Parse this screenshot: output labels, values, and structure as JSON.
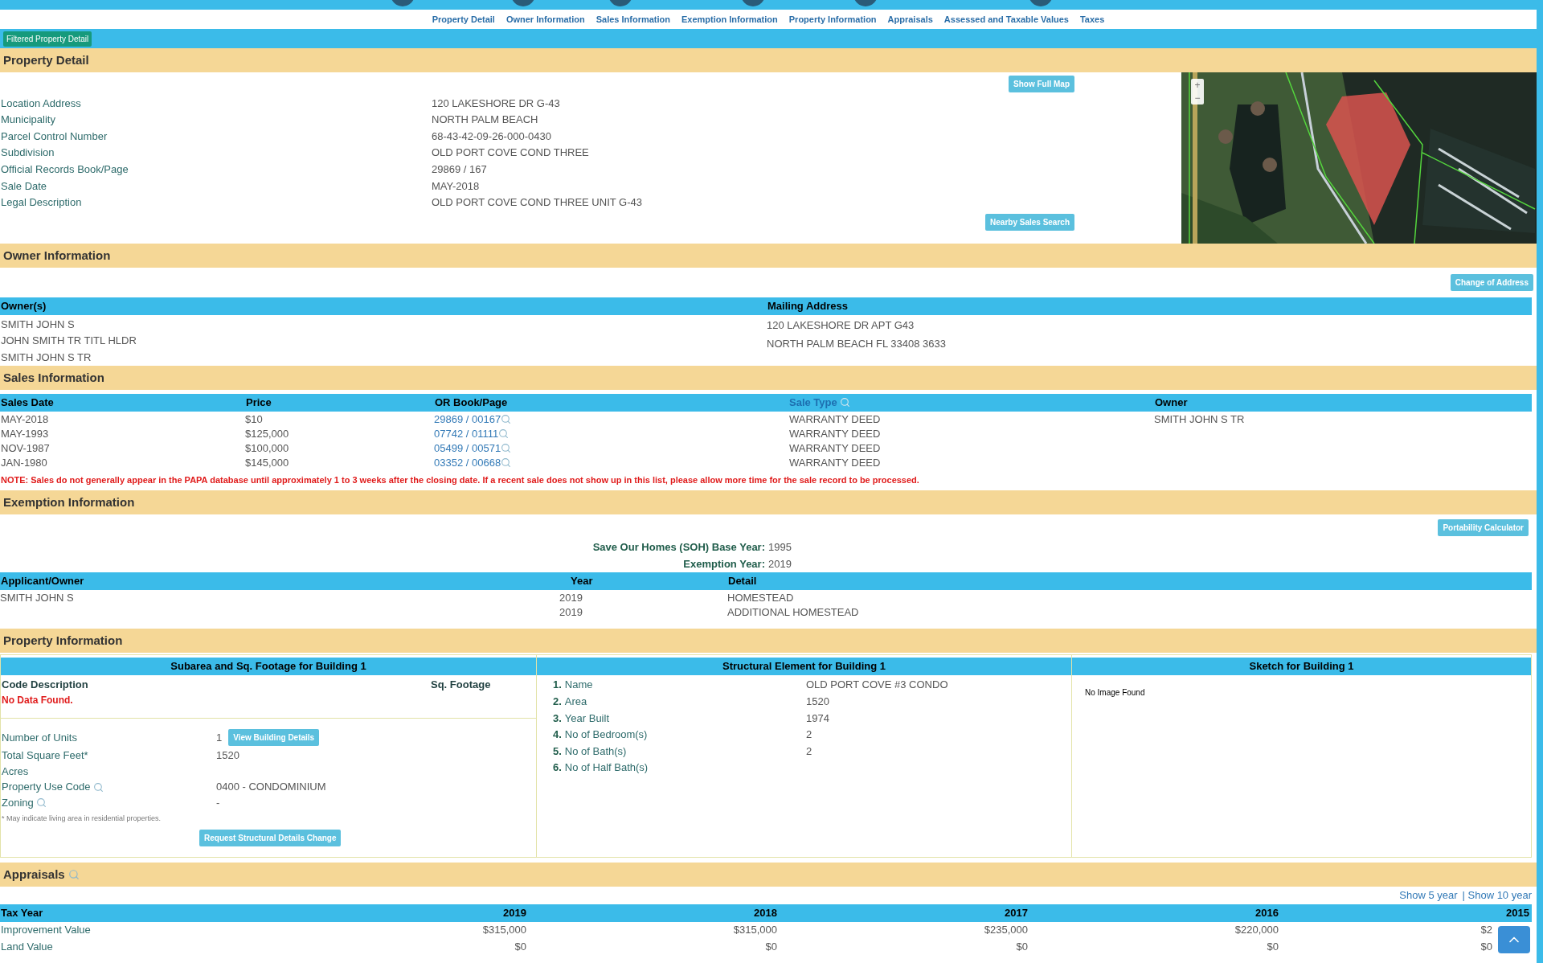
{
  "nav": {
    "links": [
      "Property Detail",
      "Owner Information",
      "Sales Information",
      "Exemption Information",
      "Property Information",
      "Appraisals",
      "Assessed and Taxable Values",
      "Taxes"
    ]
  },
  "filter_badge": "Filtered Property Detail",
  "property_detail": {
    "title": "Property Detail",
    "show_map_button": "Show Full Map",
    "nearby_button": "Nearby Sales Search",
    "fields": [
      {
        "label": "Location Address",
        "value": "120 LAKESHORE DR G-43"
      },
      {
        "label": "Municipality",
        "value": "NORTH PALM BEACH"
      },
      {
        "label": "Parcel Control Number",
        "value": "68-43-42-09-26-000-0430"
      },
      {
        "label": "Subdivision",
        "value": "OLD PORT COVE COND THREE"
      },
      {
        "label": "Official Records Book/Page",
        "value": "29869 / 167"
      },
      {
        "label": "Sale Date",
        "value": "MAY-2018"
      },
      {
        "label": "Legal Description",
        "value": "OLD PORT COVE COND THREE UNIT G-43"
      }
    ],
    "map": {
      "zoom_in": "+",
      "zoom_out": "−"
    }
  },
  "owner_information": {
    "title": "Owner Information",
    "button": "Change of Address",
    "columns": [
      "Owner(s)",
      "Mailing Address"
    ],
    "owners": [
      "SMITH JOHN S",
      "JOHN SMITH TR TITL HLDR",
      "SMITH JOHN S TR"
    ],
    "mailing_address": [
      "120 LAKESHORE DR APT G43",
      "NORTH PALM BEACH FL 33408 3633"
    ]
  },
  "sales_information": {
    "title": "Sales Information",
    "columns": [
      {
        "label": "Sales Date",
        "kind": "text"
      },
      {
        "label": "Price",
        "kind": "text"
      },
      {
        "label": "OR Book/Page",
        "kind": "text"
      },
      {
        "label": "Sale Type",
        "kind": "link"
      },
      {
        "label": "Owner",
        "kind": "text"
      }
    ],
    "rows": [
      {
        "date": "MAY-2018",
        "price": "$10",
        "book_page": "29869 / 00167",
        "sale_type": "WARRANTY DEED",
        "owner": "SMITH JOHN S TR"
      },
      {
        "date": "MAY-1993",
        "price": "$125,000",
        "book_page": "07742 / 01111",
        "sale_type": "WARRANTY DEED"
      },
      {
        "date": "NOV-1987",
        "price": "$100,000",
        "book_page": "05499 / 00571",
        "sale_type": "WARRANTY DEED"
      },
      {
        "date": "JAN-1980",
        "price": "$145,000",
        "book_page": "03352 / 00668",
        "sale_type": "WARRANTY DEED"
      }
    ],
    "note": "NOTE: Sales do not generally appear in the PAPA database until approximately 1 to 3 weeks after the closing date. If a recent sale does not show up in this list, please allow more time for the sale record to be processed."
  },
  "exemption_information": {
    "title": "Exemption Information",
    "button": "Portability Calculator",
    "summary": [
      {
        "label": "Save Our Homes (SOH) Base Year:",
        "value": "1995"
      },
      {
        "label": "Exemption Year:",
        "value": "2019"
      }
    ],
    "columns": [
      "Applicant/Owner",
      "Year",
      "Detail"
    ],
    "rows": [
      {
        "applicant": "SMITH JOHN S",
        "year": "2019",
        "detail": "HOMESTEAD"
      },
      {
        "year": "2019",
        "detail": "ADDITIONAL HOMESTEAD"
      }
    ]
  },
  "property_information": {
    "title": "Property Information",
    "subarea": {
      "title": "Subarea and Sq. Footage for Building 1",
      "columns": [
        "Code Description",
        "Sq. Footage"
      ],
      "no_data": "No Data Found.",
      "fields": [
        {
          "label": "Number of Units",
          "value": "1",
          "button": "View Building Details"
        },
        {
          "label": "Total Square Feet*",
          "value": "1520"
        },
        {
          "label": "Acres"
        },
        {
          "label": "Property Use Code",
          "value": "0400 - CONDOMINIUM",
          "search": true
        },
        {
          "label": "Zoning",
          "value": "-",
          "search": true
        }
      ],
      "footnote": "* May indicate living area in residential properties.",
      "button": "Request Structural Details Change"
    },
    "structural": {
      "title": "Structural Element for Building 1",
      "items": [
        {
          "number": "1.",
          "label": "Name",
          "value": "OLD PORT COVE #3 CONDO"
        },
        {
          "number": "2.",
          "label": "Area",
          "value": "1520"
        },
        {
          "number": "3.",
          "label": "Year Built",
          "value": "1974"
        },
        {
          "number": "4.",
          "label": "No of Bedroom(s)",
          "value": "2"
        },
        {
          "number": "5.",
          "label": "No of Bath(s)",
          "value": "2"
        },
        {
          "number": "6.",
          "label": "No of Half Bath(s)"
        }
      ]
    },
    "sketch": {
      "title": "Sketch for Building 1",
      "text": "No Image Found"
    }
  },
  "appraisals": {
    "title": "Appraisals",
    "links": [
      "Show 5 year",
      "| Show 10 year"
    ],
    "columns": [
      "Tax Year",
      "2019",
      "2018",
      "2017",
      "2016",
      "2015"
    ],
    "rows": [
      {
        "label": "Improvement Value",
        "values": [
          "$315,000",
          "$315,000",
          "$235,000",
          "$220,000",
          "$2"
        ]
      },
      {
        "label": "Land Value",
        "values": [
          "$0",
          "$0",
          "$0",
          "$0",
          "$0"
        ]
      }
    ]
  }
}
